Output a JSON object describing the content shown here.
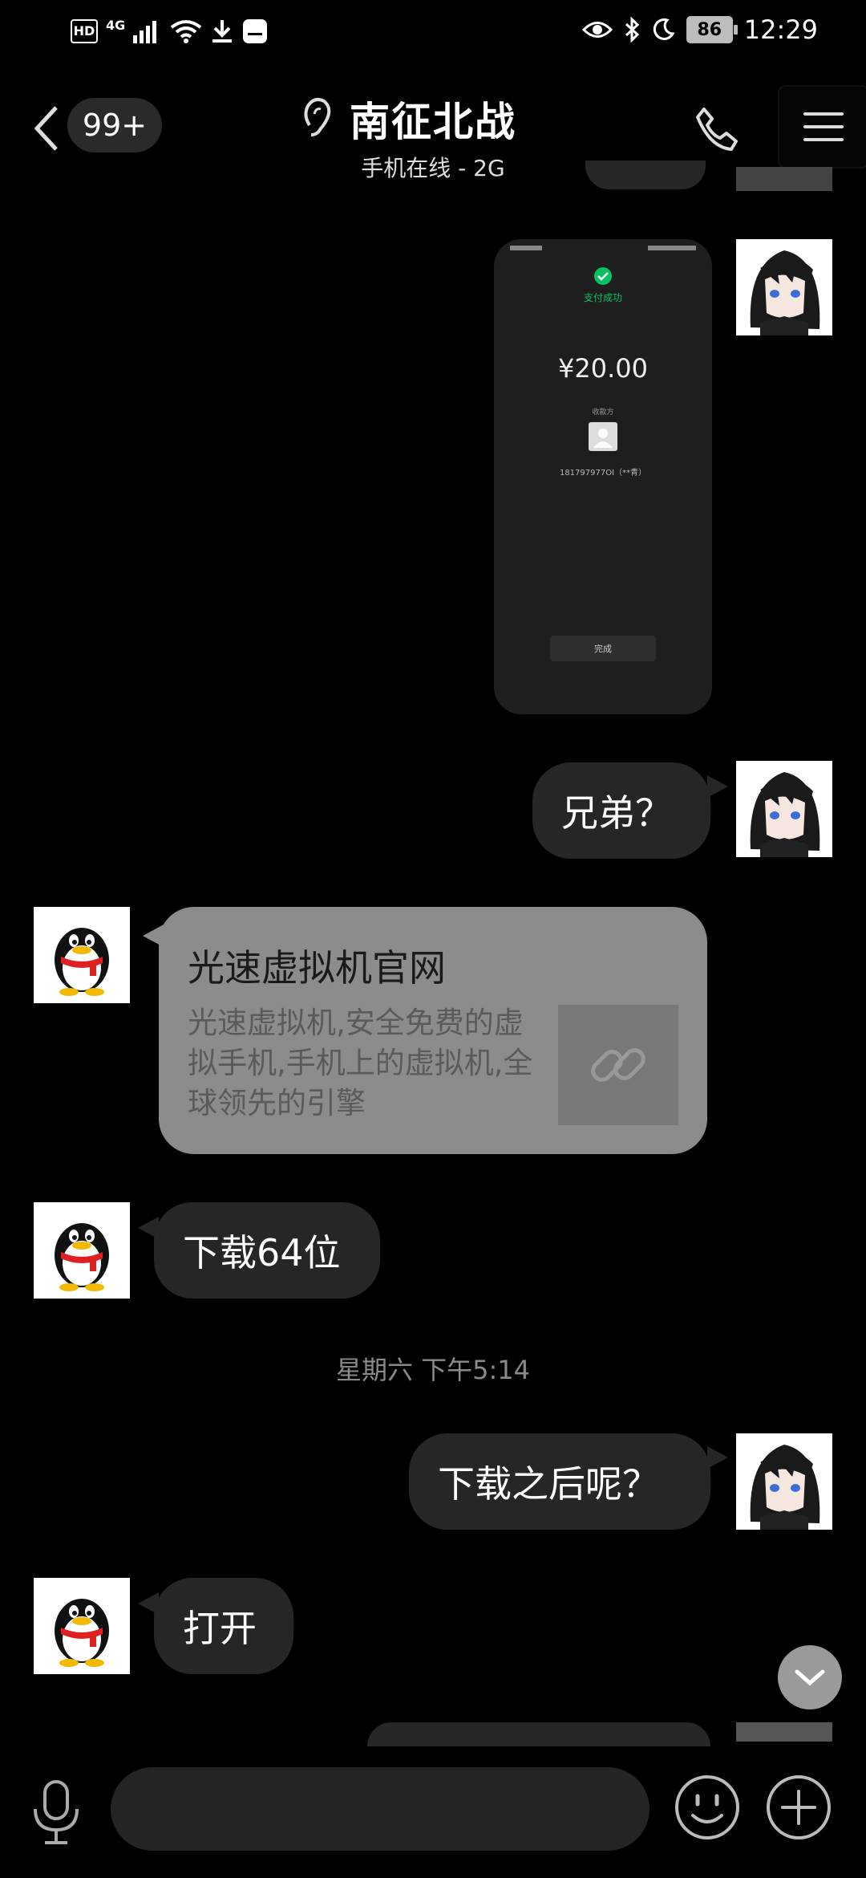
{
  "status_bar": {
    "hd": "HD",
    "network": "4G",
    "battery": "86",
    "time": "12:29"
  },
  "header": {
    "unread_count": "99+",
    "title": "南征北战",
    "subtitle": "手机在线 - 2G"
  },
  "payment_screenshot": {
    "status": "支付成功",
    "amount": "¥20.00",
    "payee_label": "收款方",
    "payee": "181797977OI（**青）",
    "done_button": "完成"
  },
  "messages": {
    "m1": "兄弟？",
    "link_card": {
      "title": "光速虚拟机官网",
      "description": "光速虚拟机,安全免费的虚拟手机,手机上的虚拟机,全球领先的引擎"
    },
    "m2": "下载64位",
    "timestamp": "星期六 下午5:14",
    "m3": "下载之后呢？",
    "m4": "打开"
  },
  "colors": {
    "background": "#000000",
    "bubble": "#262626",
    "card": "#8c8c8c",
    "wechat_green": "#07c160"
  },
  "icons": [
    "back-icon",
    "ear-icon",
    "phone-icon",
    "menu-icon",
    "mic-icon",
    "emoji-icon",
    "plus-icon",
    "chevron-down-icon",
    "link-icon"
  ]
}
